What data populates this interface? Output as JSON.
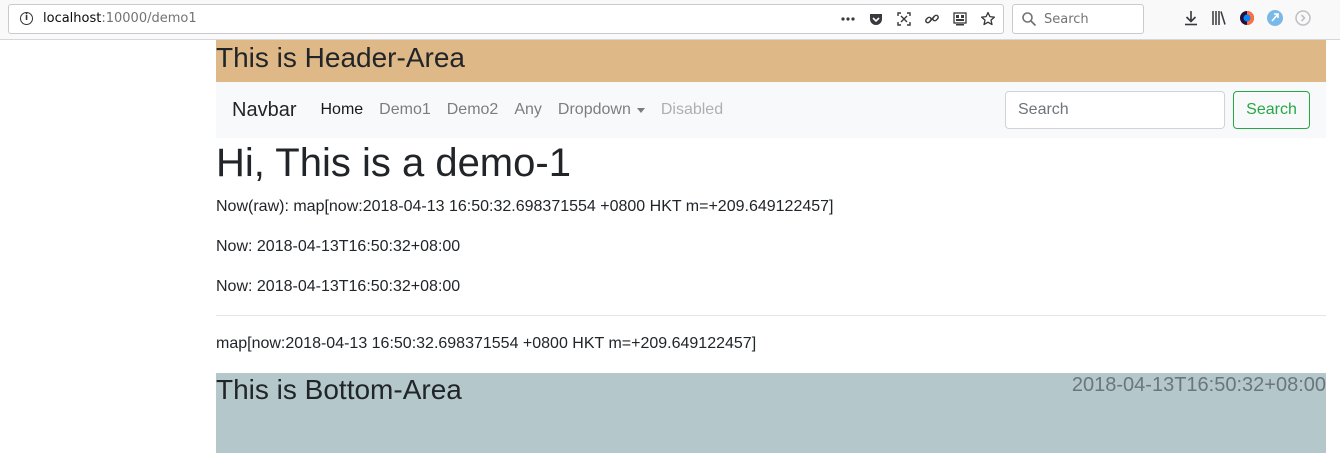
{
  "browser": {
    "url_host": "localhost",
    "url_rest": ":10000/demo1",
    "search_placeholder": "Search"
  },
  "header": {
    "text": "This is Header-Area"
  },
  "navbar": {
    "brand": "Navbar",
    "links": [
      {
        "label": "Home"
      },
      {
        "label": "Demo1"
      },
      {
        "label": "Demo2"
      },
      {
        "label": "Any"
      },
      {
        "label": "Dropdown"
      },
      {
        "label": "Disabled"
      }
    ],
    "search_placeholder": "Search",
    "search_button": "Search"
  },
  "main": {
    "title": "Hi, This is a demo-1",
    "line_raw": "Now(raw): map[now:2018-04-13 16:50:32.698371554 +0800 HKT m=+209.649122457]",
    "line_now1": "Now: 2018-04-13T16:50:32+08:00",
    "line_now2": "Now: 2018-04-13T16:50:32+08:00",
    "line_map": "map[now:2018-04-13 16:50:32.698371554 +0800 HKT m=+209.649122457]"
  },
  "bottom": {
    "text": "This is Bottom-Area",
    "time": "2018-04-13T16:50:32+08:00"
  },
  "colors": {
    "header_bg": "#deb887",
    "bottom_bg": "#b4c8cc",
    "navbar_bg": "#f8f9fa",
    "success": "#28a745"
  }
}
